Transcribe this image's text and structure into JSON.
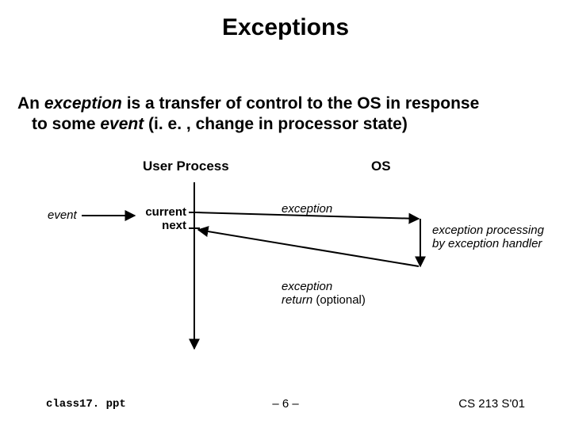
{
  "title": "Exceptions",
  "body": {
    "line1_a": "An ",
    "line1_b": "exception",
    "line1_c": " is a transfer of control to the OS in response",
    "line2_a": "to some ",
    "line2_b": "event",
    "line2_c": "  (i. e. , change in processor state)"
  },
  "labels": {
    "user_process": "User Process",
    "os": "OS",
    "event": "event",
    "current": "current",
    "next": "next",
    "exception": "exception",
    "exception_processing": "exception processing",
    "by_handler": "by exception handler",
    "exception_return_a": "exception",
    "exception_return_b": "return",
    "exception_return_c": " (optional)"
  },
  "footer": {
    "left": "class17. ppt",
    "center": "– 6 –",
    "right": "CS 213 S'01"
  }
}
